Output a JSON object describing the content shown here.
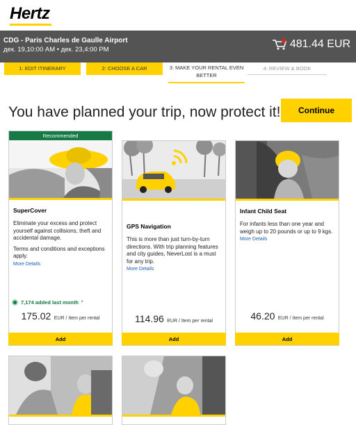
{
  "brand": {
    "logo_text": "Hertz",
    "accent": "#ffd100"
  },
  "trip": {
    "location": "CDG - Paris Charles de Gaulle Airport",
    "dates": "дек. 19,10:00 AM • дек. 23,4:00 PM",
    "total": "481.44 EUR",
    "bar_color": "#545454"
  },
  "steps": [
    {
      "label": "1:  EDIT ITINERARY",
      "state": "done"
    },
    {
      "label": "2:  CHOOSE A CAR",
      "state": "done"
    },
    {
      "label_line1": "3:  MAKE YOUR RENTAL EVEN",
      "label_line2": "BETTER",
      "state": "current"
    },
    {
      "label": "4:  REVIEW & BOOK",
      "state": "future"
    }
  ],
  "headline": "You have planned your trip, now protect it!",
  "continue_label": "Continue",
  "cards": [
    {
      "badge": "Recommended",
      "badge_color": "#157a45",
      "title": "SuperCover",
      "desc1": "Eliminate your excess and protect yourself against collisions, theft and accidental damage.",
      "desc2": "Terms and conditions and exceptions apply.",
      "more": "More Details",
      "added": "7,174 added last month",
      "added_mark": "*",
      "price": "175.02",
      "unit": "EUR / Item per rental",
      "add": "Add",
      "image": "woman-in-sun-hat-driving"
    },
    {
      "title": "GPS Navigation",
      "desc1": "This is more than just turn-by-turn directions. With trip planning features and city guides, NeverLost is a must for any trip.",
      "more": "More Details",
      "price": "114.96",
      "unit": "EUR / Item per rental",
      "add": "Add",
      "image": "yellow-car-with-signal-icon"
    },
    {
      "title": "Infant Child Seat",
      "desc1": "For infants less than one year and weigh up to 20 pounds or up to 9 kgs.",
      "more": "More Details",
      "price": "46.20",
      "unit": "EUR / Item per rental",
      "add": "Add",
      "image": "baby-in-car-seat"
    },
    {
      "image": "man-with-child-in-car-seat"
    },
    {
      "image": "woman-buckling-child-seat"
    }
  ]
}
